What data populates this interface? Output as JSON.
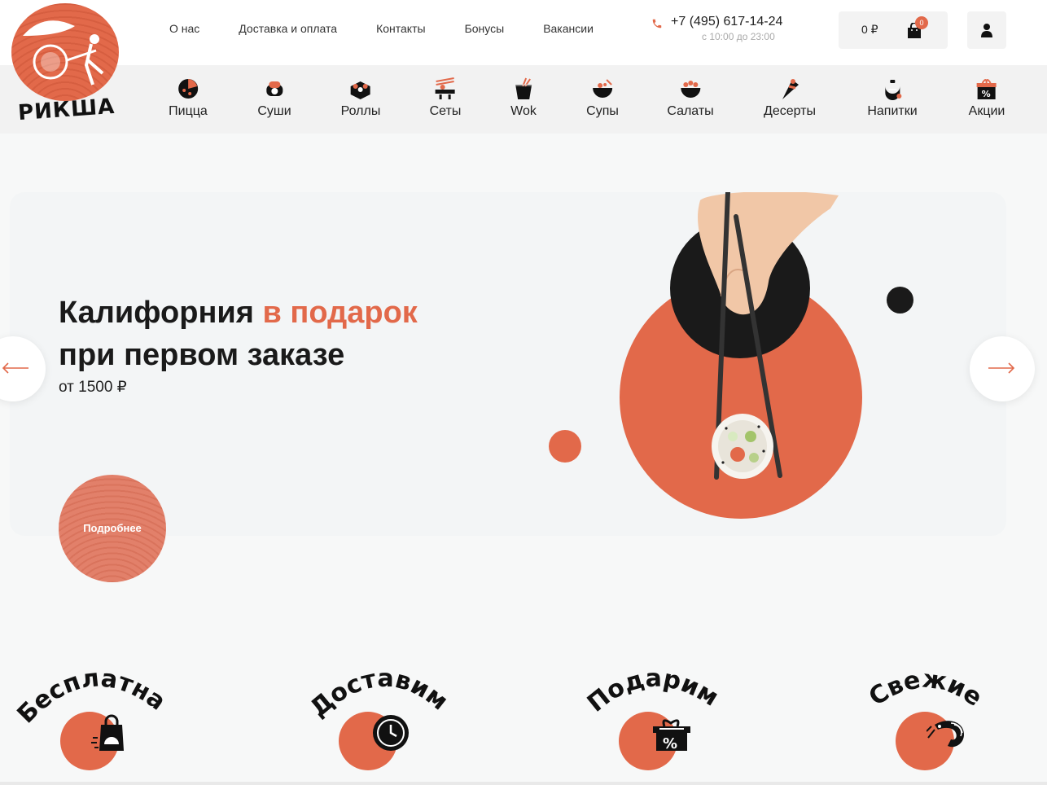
{
  "brand": {
    "logo_text": "РИКША"
  },
  "top_nav": [
    {
      "label": "О нас"
    },
    {
      "label": "Доставка и оплата"
    },
    {
      "label": "Контакты"
    },
    {
      "label": "Бонусы"
    },
    {
      "label": "Вакансии"
    }
  ],
  "contact": {
    "phone": "+7 (495) 617-14-24",
    "hours": "с 10:00 до 23:00"
  },
  "cart": {
    "sum": "0 ₽",
    "count": "0"
  },
  "categories": [
    {
      "label": "Пицца",
      "icon": "pizza-icon"
    },
    {
      "label": "Суши",
      "icon": "sushi-icon"
    },
    {
      "label": "Роллы",
      "icon": "rolls-icon"
    },
    {
      "label": "Сеты",
      "icon": "sets-icon"
    },
    {
      "label": "Wok",
      "icon": "wok-icon"
    },
    {
      "label": "Супы",
      "icon": "soup-icon"
    },
    {
      "label": "Салаты",
      "icon": "salad-icon"
    },
    {
      "label": "Десерты",
      "icon": "dessert-icon"
    },
    {
      "label": "Напитки",
      "icon": "drinks-icon"
    },
    {
      "label": "Акции",
      "icon": "promo-icon"
    }
  ],
  "hero": {
    "title_part1": "Калифорния ",
    "title_accent": "в подарок",
    "title_line2": "при первом заказе",
    "subtitle": "от 1500 ₽",
    "button": "Подробнее"
  },
  "features": [
    {
      "word": "Бесплатная",
      "icon": "delivery-bag-icon"
    },
    {
      "word": "Доставим",
      "icon": "clock-icon"
    },
    {
      "word": "Подарим",
      "icon": "gift-percent-icon"
    },
    {
      "word": "Свежие",
      "icon": "shrimp-icon"
    }
  ],
  "colors": {
    "accent": "#e2694a",
    "dark": "#1a1a1a",
    "bg": "#f7f8f8"
  }
}
